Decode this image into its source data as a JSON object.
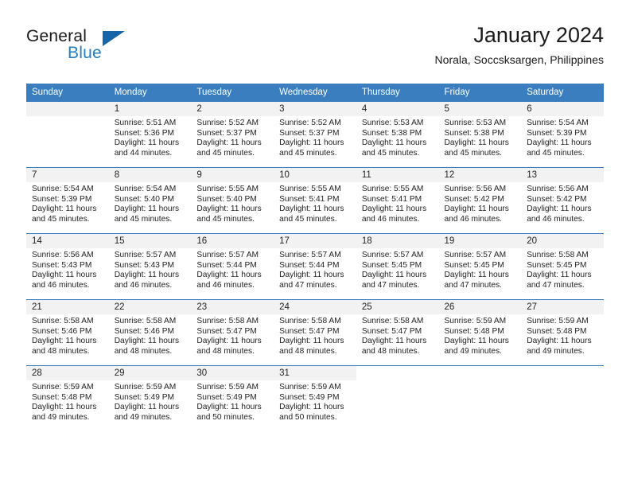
{
  "brand": {
    "name_part1": "General",
    "name_part2": "Blue",
    "accent_color": "#1f7ec4",
    "triangle_color": "#1565a8"
  },
  "header": {
    "title": "January 2024",
    "subtitle": "Norala, Soccsksargen, Philippines"
  },
  "theme": {
    "header_row_bg": "#3a7ebf",
    "daynum_bg": "#f2f2f2",
    "grid_line": "#3a7ebf",
    "text": "#222222"
  },
  "weekdays": [
    "Sunday",
    "Monday",
    "Tuesday",
    "Wednesday",
    "Thursday",
    "Friday",
    "Saturday"
  ],
  "weeks": [
    [
      {
        "day": "",
        "sunrise": "",
        "sunset": "",
        "daylight1": "",
        "daylight2": ""
      },
      {
        "day": "1",
        "sunrise": "Sunrise: 5:51 AM",
        "sunset": "Sunset: 5:36 PM",
        "daylight1": "Daylight: 11 hours",
        "daylight2": "and 44 minutes."
      },
      {
        "day": "2",
        "sunrise": "Sunrise: 5:52 AM",
        "sunset": "Sunset: 5:37 PM",
        "daylight1": "Daylight: 11 hours",
        "daylight2": "and 45 minutes."
      },
      {
        "day": "3",
        "sunrise": "Sunrise: 5:52 AM",
        "sunset": "Sunset: 5:37 PM",
        "daylight1": "Daylight: 11 hours",
        "daylight2": "and 45 minutes."
      },
      {
        "day": "4",
        "sunrise": "Sunrise: 5:53 AM",
        "sunset": "Sunset: 5:38 PM",
        "daylight1": "Daylight: 11 hours",
        "daylight2": "and 45 minutes."
      },
      {
        "day": "5",
        "sunrise": "Sunrise: 5:53 AM",
        "sunset": "Sunset: 5:38 PM",
        "daylight1": "Daylight: 11 hours",
        "daylight2": "and 45 minutes."
      },
      {
        "day": "6",
        "sunrise": "Sunrise: 5:54 AM",
        "sunset": "Sunset: 5:39 PM",
        "daylight1": "Daylight: 11 hours",
        "daylight2": "and 45 minutes."
      }
    ],
    [
      {
        "day": "7",
        "sunrise": "Sunrise: 5:54 AM",
        "sunset": "Sunset: 5:39 PM",
        "daylight1": "Daylight: 11 hours",
        "daylight2": "and 45 minutes."
      },
      {
        "day": "8",
        "sunrise": "Sunrise: 5:54 AM",
        "sunset": "Sunset: 5:40 PM",
        "daylight1": "Daylight: 11 hours",
        "daylight2": "and 45 minutes."
      },
      {
        "day": "9",
        "sunrise": "Sunrise: 5:55 AM",
        "sunset": "Sunset: 5:40 PM",
        "daylight1": "Daylight: 11 hours",
        "daylight2": "and 45 minutes."
      },
      {
        "day": "10",
        "sunrise": "Sunrise: 5:55 AM",
        "sunset": "Sunset: 5:41 PM",
        "daylight1": "Daylight: 11 hours",
        "daylight2": "and 45 minutes."
      },
      {
        "day": "11",
        "sunrise": "Sunrise: 5:55 AM",
        "sunset": "Sunset: 5:41 PM",
        "daylight1": "Daylight: 11 hours",
        "daylight2": "and 46 minutes."
      },
      {
        "day": "12",
        "sunrise": "Sunrise: 5:56 AM",
        "sunset": "Sunset: 5:42 PM",
        "daylight1": "Daylight: 11 hours",
        "daylight2": "and 46 minutes."
      },
      {
        "day": "13",
        "sunrise": "Sunrise: 5:56 AM",
        "sunset": "Sunset: 5:42 PM",
        "daylight1": "Daylight: 11 hours",
        "daylight2": "and 46 minutes."
      }
    ],
    [
      {
        "day": "14",
        "sunrise": "Sunrise: 5:56 AM",
        "sunset": "Sunset: 5:43 PM",
        "daylight1": "Daylight: 11 hours",
        "daylight2": "and 46 minutes."
      },
      {
        "day": "15",
        "sunrise": "Sunrise: 5:57 AM",
        "sunset": "Sunset: 5:43 PM",
        "daylight1": "Daylight: 11 hours",
        "daylight2": "and 46 minutes."
      },
      {
        "day": "16",
        "sunrise": "Sunrise: 5:57 AM",
        "sunset": "Sunset: 5:44 PM",
        "daylight1": "Daylight: 11 hours",
        "daylight2": "and 46 minutes."
      },
      {
        "day": "17",
        "sunrise": "Sunrise: 5:57 AM",
        "sunset": "Sunset: 5:44 PM",
        "daylight1": "Daylight: 11 hours",
        "daylight2": "and 47 minutes."
      },
      {
        "day": "18",
        "sunrise": "Sunrise: 5:57 AM",
        "sunset": "Sunset: 5:45 PM",
        "daylight1": "Daylight: 11 hours",
        "daylight2": "and 47 minutes."
      },
      {
        "day": "19",
        "sunrise": "Sunrise: 5:57 AM",
        "sunset": "Sunset: 5:45 PM",
        "daylight1": "Daylight: 11 hours",
        "daylight2": "and 47 minutes."
      },
      {
        "day": "20",
        "sunrise": "Sunrise: 5:58 AM",
        "sunset": "Sunset: 5:45 PM",
        "daylight1": "Daylight: 11 hours",
        "daylight2": "and 47 minutes."
      }
    ],
    [
      {
        "day": "21",
        "sunrise": "Sunrise: 5:58 AM",
        "sunset": "Sunset: 5:46 PM",
        "daylight1": "Daylight: 11 hours",
        "daylight2": "and 48 minutes."
      },
      {
        "day": "22",
        "sunrise": "Sunrise: 5:58 AM",
        "sunset": "Sunset: 5:46 PM",
        "daylight1": "Daylight: 11 hours",
        "daylight2": "and 48 minutes."
      },
      {
        "day": "23",
        "sunrise": "Sunrise: 5:58 AM",
        "sunset": "Sunset: 5:47 PM",
        "daylight1": "Daylight: 11 hours",
        "daylight2": "and 48 minutes."
      },
      {
        "day": "24",
        "sunrise": "Sunrise: 5:58 AM",
        "sunset": "Sunset: 5:47 PM",
        "daylight1": "Daylight: 11 hours",
        "daylight2": "and 48 minutes."
      },
      {
        "day": "25",
        "sunrise": "Sunrise: 5:58 AM",
        "sunset": "Sunset: 5:47 PM",
        "daylight1": "Daylight: 11 hours",
        "daylight2": "and 48 minutes."
      },
      {
        "day": "26",
        "sunrise": "Sunrise: 5:59 AM",
        "sunset": "Sunset: 5:48 PM",
        "daylight1": "Daylight: 11 hours",
        "daylight2": "and 49 minutes."
      },
      {
        "day": "27",
        "sunrise": "Sunrise: 5:59 AM",
        "sunset": "Sunset: 5:48 PM",
        "daylight1": "Daylight: 11 hours",
        "daylight2": "and 49 minutes."
      }
    ],
    [
      {
        "day": "28",
        "sunrise": "Sunrise: 5:59 AM",
        "sunset": "Sunset: 5:48 PM",
        "daylight1": "Daylight: 11 hours",
        "daylight2": "and 49 minutes."
      },
      {
        "day": "29",
        "sunrise": "Sunrise: 5:59 AM",
        "sunset": "Sunset: 5:49 PM",
        "daylight1": "Daylight: 11 hours",
        "daylight2": "and 49 minutes."
      },
      {
        "day": "30",
        "sunrise": "Sunrise: 5:59 AM",
        "sunset": "Sunset: 5:49 PM",
        "daylight1": "Daylight: 11 hours",
        "daylight2": "and 50 minutes."
      },
      {
        "day": "31",
        "sunrise": "Sunrise: 5:59 AM",
        "sunset": "Sunset: 5:49 PM",
        "daylight1": "Daylight: 11 hours",
        "daylight2": "and 50 minutes."
      },
      {
        "day": "",
        "sunrise": "",
        "sunset": "",
        "daylight1": "",
        "daylight2": ""
      },
      {
        "day": "",
        "sunrise": "",
        "sunset": "",
        "daylight1": "",
        "daylight2": ""
      },
      {
        "day": "",
        "sunrise": "",
        "sunset": "",
        "daylight1": "",
        "daylight2": ""
      }
    ]
  ]
}
